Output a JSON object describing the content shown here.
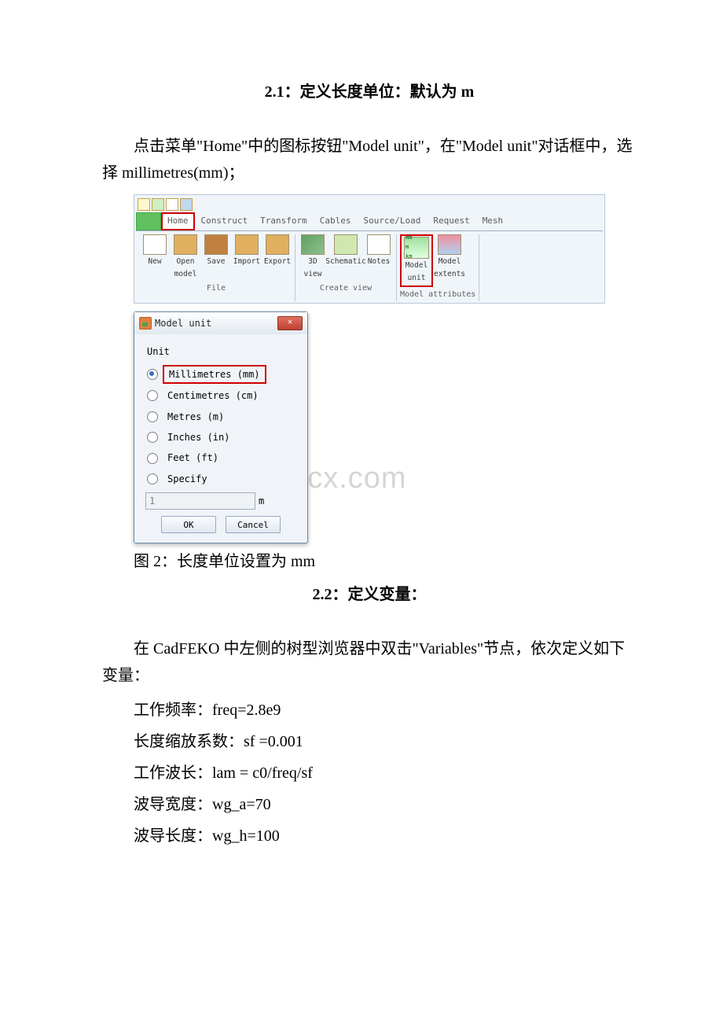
{
  "headings": {
    "s21": "2.1：定义长度单位：默认为 m",
    "s22": "2.2：定义变量："
  },
  "paragraphs": {
    "p1": "点击菜单\"Home\"中的图标按钮\"Model unit\"，在\"Model unit\"对话框中，选择 millimetres(mm)；",
    "caption": "图 2：长度单位设置为 mm",
    "p2": "在 CadFEKO 中左侧的树型浏览器中双击\"Variables\"节点，依次定义如下变量：",
    "v1": "工作频率：freq=2.8e9",
    "v2": "长度缩放系数：sf =0.001",
    "v3": "工作波长：lam = c0/freq/sf",
    "v4": "波导宽度：wg_a=70",
    "v5": "波导长度：wg_h=100"
  },
  "toolbar": {
    "tabs": [
      "Home",
      "Construct",
      "Transform",
      "Cables",
      "Source/Load",
      "Request",
      "Mesh"
    ],
    "file_group": "File",
    "create_group": "Create view",
    "model_group": "Model attributes",
    "buttons": {
      "new": "New",
      "open": "Open\nmodel",
      "save": "Save",
      "import": "Import",
      "export": "Export",
      "view3d": "3D\nview",
      "schematic": "Schematic",
      "notes": "Notes",
      "model_unit": "Model\nunit",
      "model_extents": "Model\nextents"
    },
    "unit_lines": [
      "mm",
      "m",
      "km"
    ]
  },
  "dialog": {
    "title": "Model unit",
    "group": "Unit",
    "options": [
      "Millimetres (mm)",
      "Centimetres (cm)",
      "Metres (m)",
      "Inches (in)",
      "Feet (ft)",
      "Specify"
    ],
    "specify_value": "1",
    "specify_unit": "m",
    "ok": "OK",
    "cancel": "Cancel"
  },
  "watermark": "www.bdocx.com"
}
